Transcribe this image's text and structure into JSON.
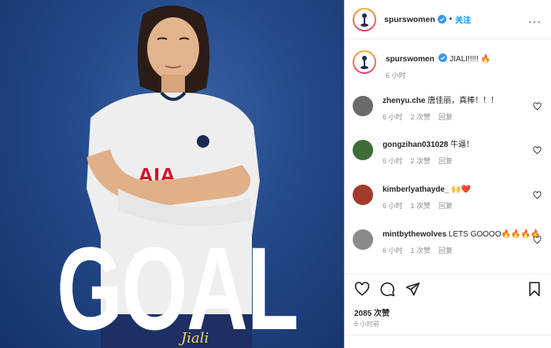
{
  "post": {
    "username": "spurswomen",
    "follow_label": "关注",
    "more_label": "···",
    "caption_user": "spurswomen",
    "caption_text": "JIALI!!!!! 🔥",
    "caption_time": "6 小时",
    "photo_text": "GOAL",
    "photo_signature": "Jiali"
  },
  "comments": [
    {
      "user": "zhenyu.che",
      "text": "唐佳丽，真棒！！！",
      "time": "6 小时",
      "likes": "2 次赞",
      "reply": "回复",
      "avatar_color": "#6b6b6b"
    },
    {
      "user": "gongzihan031028",
      "text": "牛逼！",
      "time": "6 小时",
      "likes": "2 次赞",
      "reply": "回复",
      "avatar_color": "#3f6d3a"
    },
    {
      "user": "kimberlyathayde_",
      "text": "🙌❤️",
      "time": "6 小时",
      "likes": "1 次赞",
      "reply": "回复",
      "avatar_color": "#a33b2b"
    },
    {
      "user": "mintbythewolves",
      "text": "LETS GOOOO🔥🔥🔥🔥",
      "time": "6 小时",
      "likes": "1 次赞",
      "reply": "回复",
      "avatar_color": "#8a8a8a"
    }
  ],
  "stats": {
    "likes_label": "2085 次赞",
    "post_age": "6 小时前"
  },
  "colors": {
    "accent": "#0095f6",
    "meta": "#8e8e8e",
    "photo_bg": "#23498a"
  }
}
